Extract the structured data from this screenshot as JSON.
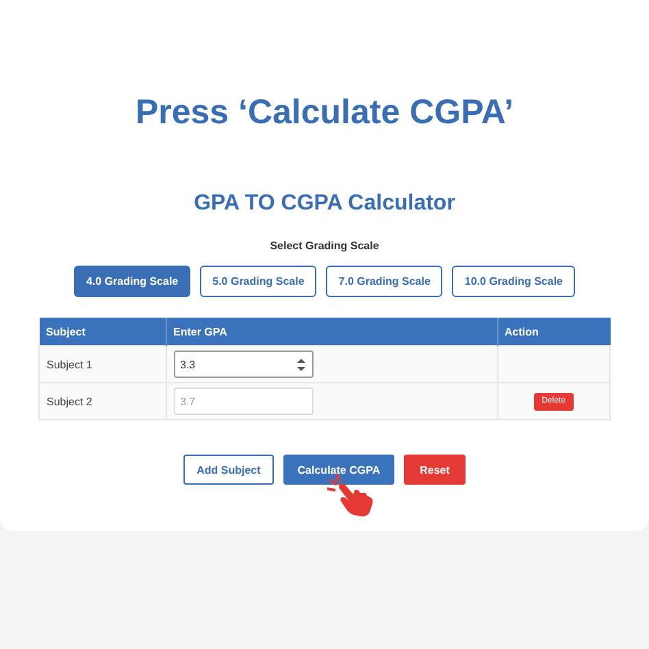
{
  "headline": "Press ‘Calculate CGPA’",
  "calculator": {
    "title": "GPA TO CGPA Calculator",
    "scale_label": "Select Grading Scale",
    "scales": [
      {
        "label": "4.0 Grading Scale",
        "selected": true
      },
      {
        "label": "5.0 Grading Scale",
        "selected": false
      },
      {
        "label": "7.0 Grading Scale",
        "selected": false
      },
      {
        "label": "10.0 Grading Scale",
        "selected": false
      }
    ],
    "table": {
      "columns": [
        "Subject",
        "Enter GPA",
        "Action"
      ],
      "rows": [
        {
          "subject": "Subject 1",
          "value": "3.3",
          "focused": true,
          "delete": false
        },
        {
          "subject": "Subject 2",
          "placeholder": "3.7",
          "focused": false,
          "delete": true,
          "delete_label": "Delete"
        }
      ]
    },
    "buttons": [
      {
        "label": "Add Subject",
        "kind": "outline"
      },
      {
        "label": "Calculate CGPA",
        "kind": "primary"
      },
      {
        "label": "Reset",
        "kind": "danger"
      }
    ]
  }
}
